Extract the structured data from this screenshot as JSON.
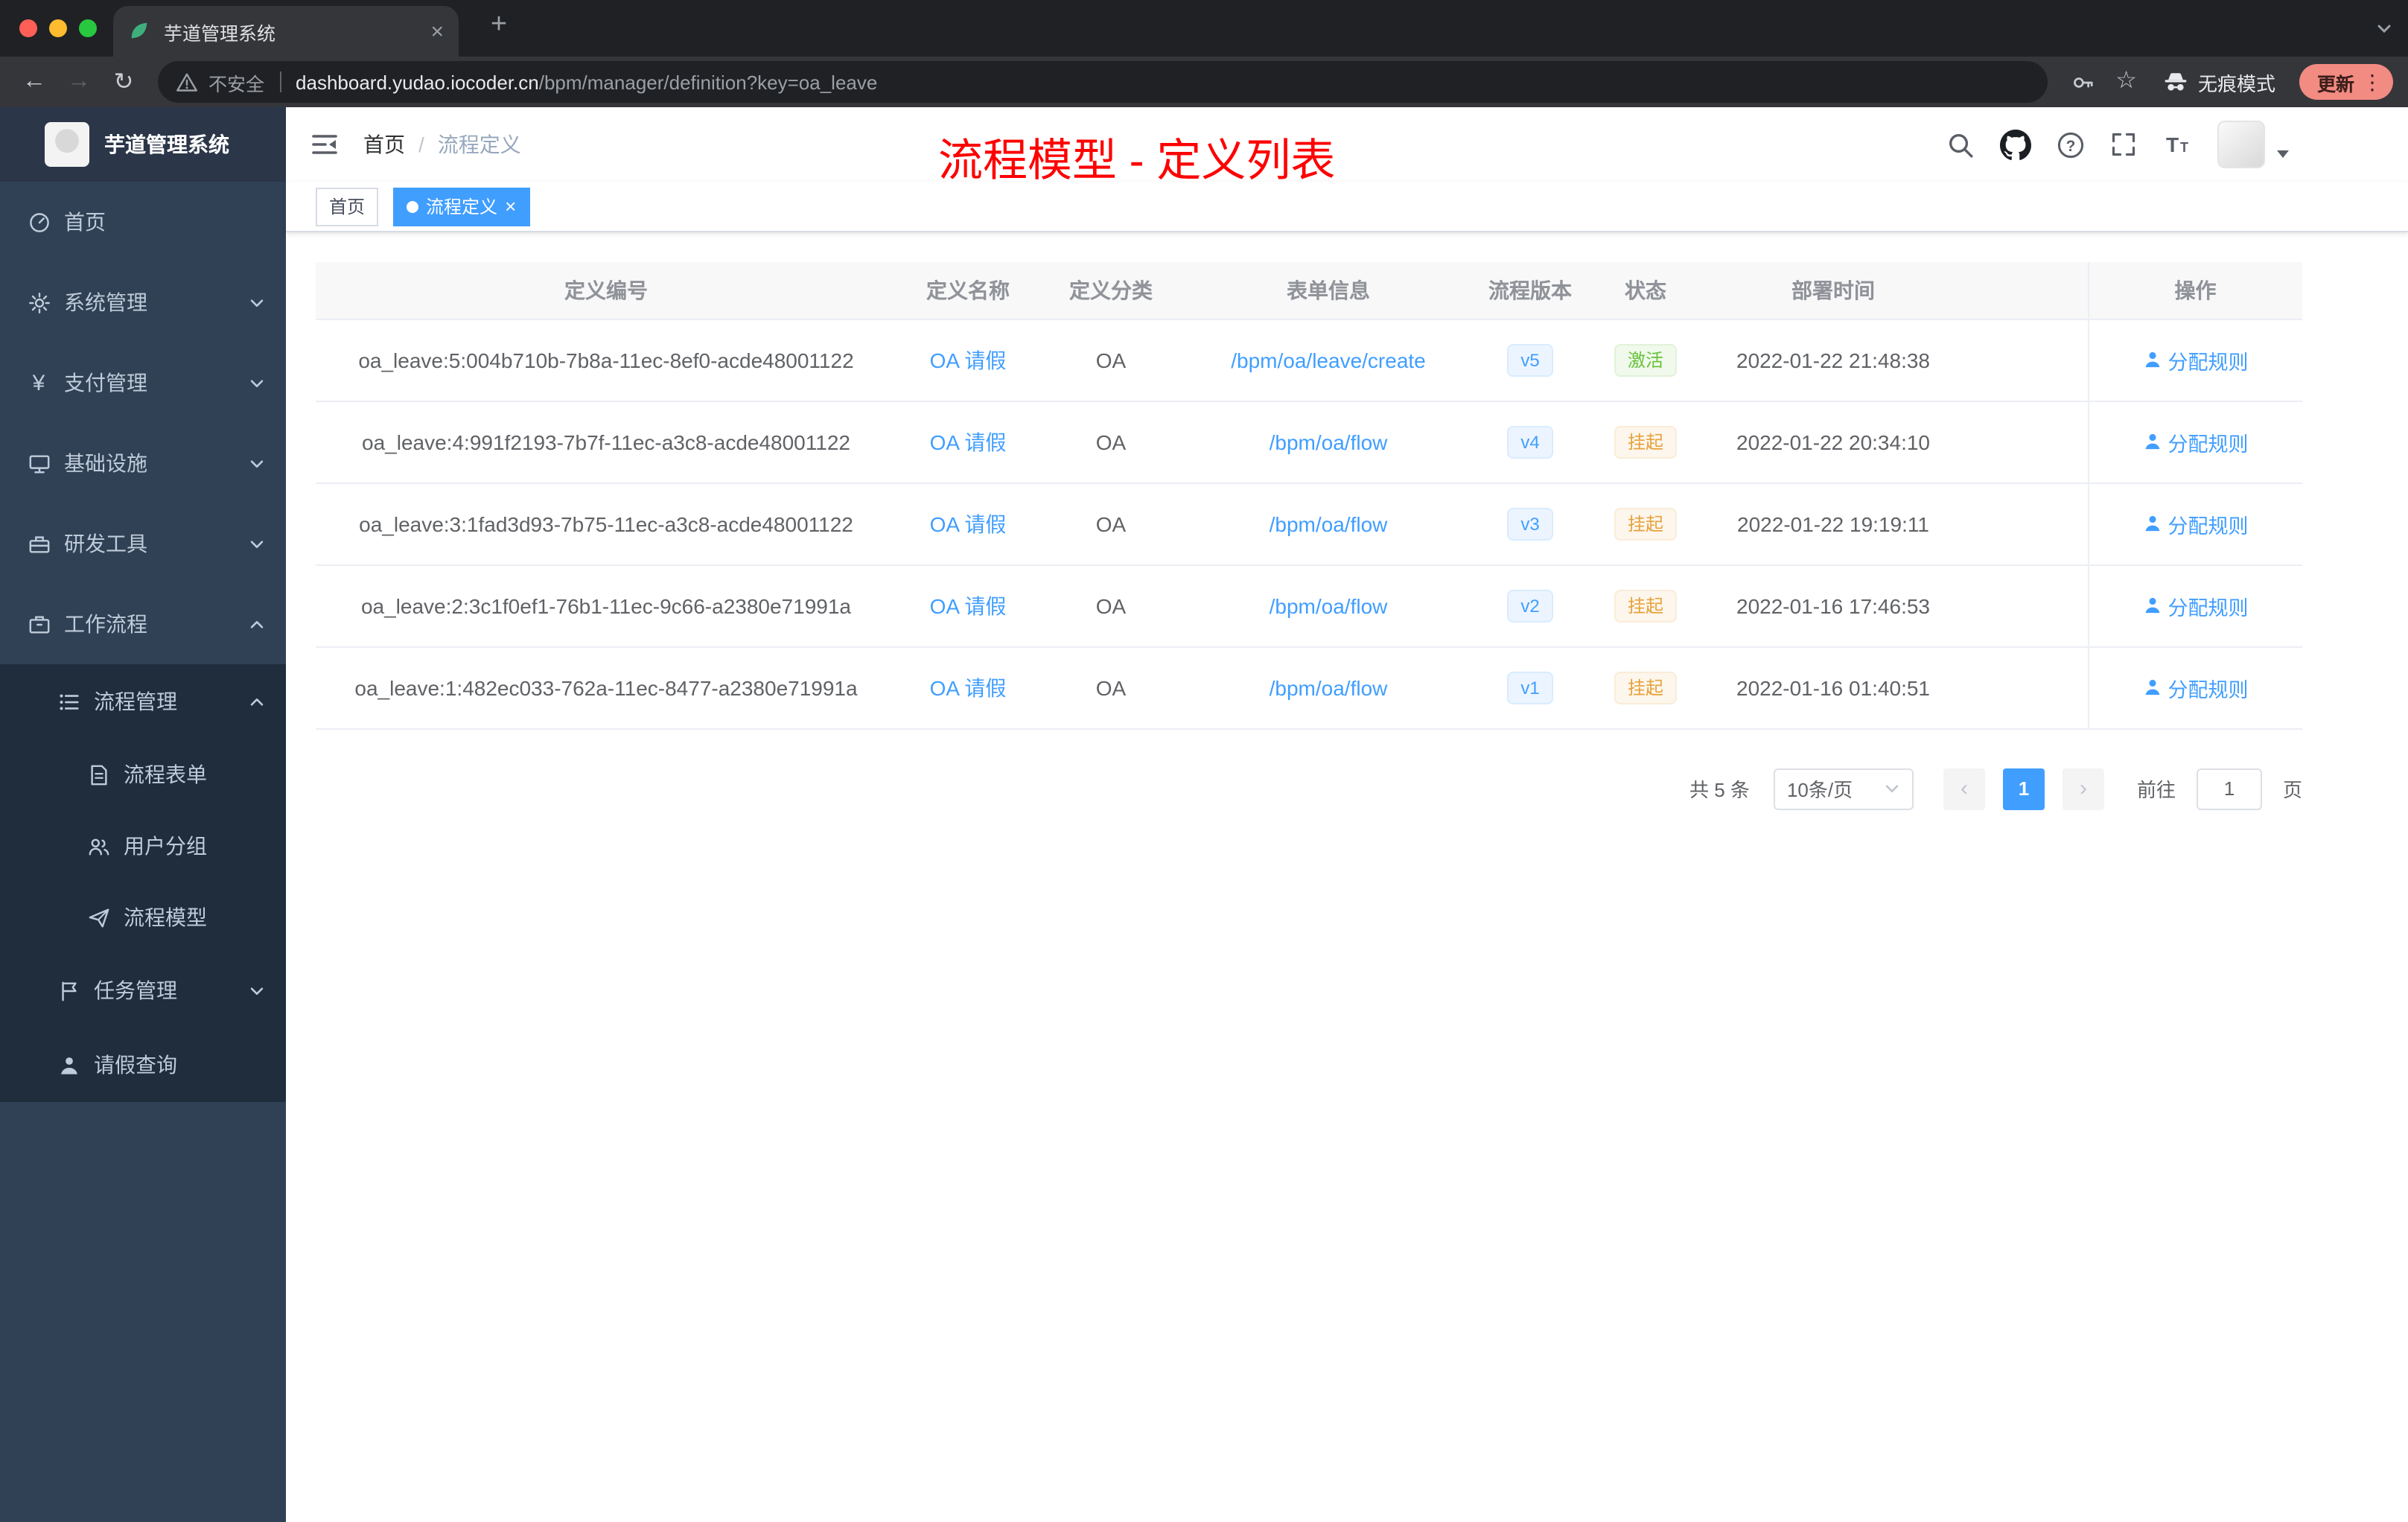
{
  "browser": {
    "tab_title": "芋道管理系统",
    "security_label": "不安全",
    "url_host": "dashboard.yudao.iocoder.cn",
    "url_path": "/bpm/manager/definition?key=oa_leave",
    "incognito_label": "无痕模式",
    "update_button": "更新"
  },
  "icons": {
    "close-icon": "×",
    "new-tab-icon": "+",
    "back-icon": "←",
    "forward-icon": "→",
    "refresh-icon": "↻",
    "star-icon": "☆",
    "more-vert-icon": "⋮",
    "prev-page-icon": "‹",
    "next-page-icon": "›",
    "yen-icon": "¥"
  },
  "sidebar": {
    "logo_title": "芋道管理系统",
    "items": [
      {
        "label": "首页",
        "icon": "dashboard-icon",
        "level": 1
      },
      {
        "label": "系统管理",
        "icon": "gear-icon",
        "level": 1,
        "state": "collapsed"
      },
      {
        "label": "支付管理",
        "icon": "yen-icon",
        "level": 1,
        "state": "collapsed"
      },
      {
        "label": "基础设施",
        "icon": "monitor-icon",
        "level": 1,
        "state": "collapsed"
      },
      {
        "label": "研发工具",
        "icon": "toolbox-icon",
        "level": 1,
        "state": "collapsed"
      },
      {
        "label": "工作流程",
        "icon": "briefcase-icon",
        "level": 1,
        "state": "expanded"
      },
      {
        "label": "流程管理",
        "icon": "list-icon",
        "level": 2,
        "state": "expanded"
      },
      {
        "label": "流程表单",
        "icon": "document-icon",
        "level": 3
      },
      {
        "label": "用户分组",
        "icon": "users-icon",
        "level": 3
      },
      {
        "label": "流程模型",
        "icon": "paper-plane-icon",
        "level": 3
      },
      {
        "label": "任务管理",
        "icon": "flag-icon",
        "level": 2,
        "state": "collapsed"
      },
      {
        "label": "请假查询",
        "icon": "person-icon",
        "level": 2
      }
    ]
  },
  "header": {
    "breadcrumb": [
      "首页",
      "流程定义"
    ],
    "breadcrumb_separator": "/",
    "annotation": "流程模型 - 定义列表",
    "right_icons": [
      "search-icon",
      "github-icon",
      "question-icon",
      "fullscreen-icon",
      "font-size-icon",
      "avatar",
      "caret-down-icon"
    ]
  },
  "tags_view": {
    "tags": [
      {
        "label": "首页",
        "active": false
      },
      {
        "label": "流程定义",
        "active": true,
        "closable": true
      }
    ]
  },
  "table": {
    "columns": [
      "定义编号",
      "定义名称",
      "定义分类",
      "表单信息",
      "流程版本",
      "状态",
      "部署时间",
      "操作"
    ],
    "rows": [
      {
        "id": "oa_leave:5:004b710b-7b8a-11ec-8ef0-acde48001122",
        "name": "OA 请假",
        "category": "OA",
        "form": "/bpm/oa/leave/create",
        "version": "v5",
        "status": "激活",
        "status_type": "success",
        "time": "2022-01-22 21:48:38",
        "action": "分配规则"
      },
      {
        "id": "oa_leave:4:991f2193-7b7f-11ec-a3c8-acde48001122",
        "name": "OA 请假",
        "category": "OA",
        "form": "/bpm/oa/flow",
        "version": "v4",
        "status": "挂起",
        "status_type": "warning",
        "time": "2022-01-22 20:34:10",
        "action": "分配规则"
      },
      {
        "id": "oa_leave:3:1fad3d93-7b75-11ec-a3c8-acde48001122",
        "name": "OA 请假",
        "category": "OA",
        "form": "/bpm/oa/flow",
        "version": "v3",
        "status": "挂起",
        "status_type": "warning",
        "time": "2022-01-22 19:19:11",
        "action": "分配规则"
      },
      {
        "id": "oa_leave:2:3c1f0ef1-76b1-11ec-9c66-a2380e71991a",
        "name": "OA 请假",
        "category": "OA",
        "form": "/bpm/oa/flow",
        "version": "v2",
        "status": "挂起",
        "status_type": "warning",
        "time": "2022-01-16 17:46:53",
        "action": "分配规则"
      },
      {
        "id": "oa_leave:1:482ec033-762a-11ec-8477-a2380e71991a",
        "name": "OA 请假",
        "category": "OA",
        "form": "/bpm/oa/flow",
        "version": "v1",
        "status": "挂起",
        "status_type": "warning",
        "time": "2022-01-16 01:40:51",
        "action": "分配规则"
      }
    ]
  },
  "pagination": {
    "total_label": "共 5 条",
    "page_size_label": "10条/页",
    "current_page": "1",
    "goto_label": "前往",
    "goto_value": "1",
    "page_unit": "页"
  },
  "colors": {
    "accent_blue": "#409eff",
    "sidebar_bg": "#304156",
    "submenu_bg": "#1f2d3d",
    "annotation_red": "#ff0000",
    "tag_success_text": "#67c23a",
    "tag_warning_text": "#e6a23c"
  }
}
